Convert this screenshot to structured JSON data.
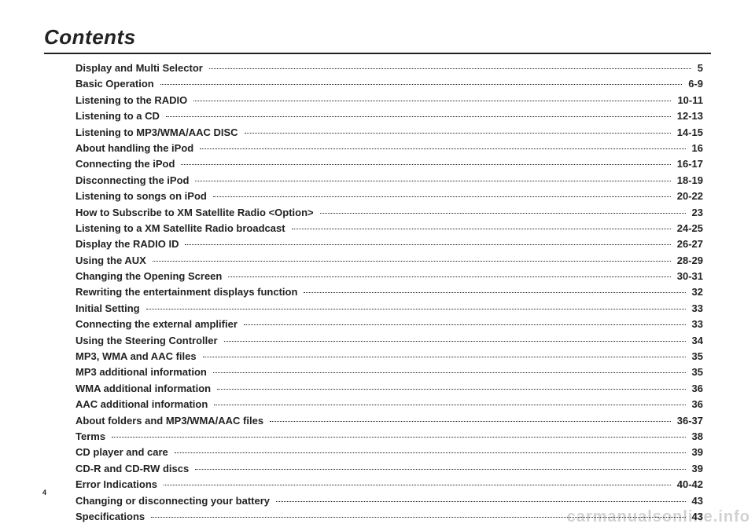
{
  "heading": "Contents",
  "page_number": "4",
  "watermark": "carmanualsonline.info",
  "toc": [
    {
      "title": "Display and Multi Selector",
      "page": "5"
    },
    {
      "title": "Basic Operation",
      "page": "6-9"
    },
    {
      "title": "Listening to the RADIO",
      "page": "10-11"
    },
    {
      "title": "Listening to a CD",
      "page": "12-13"
    },
    {
      "title": "Listening to MP3/WMA/AAC DISC",
      "page": "14-15"
    },
    {
      "title": "About handling the iPod",
      "page": "16"
    },
    {
      "title": "Connecting the iPod",
      "page": "16-17"
    },
    {
      "title": "Disconnecting the iPod",
      "page": "18-19"
    },
    {
      "title": "Listening to songs on iPod",
      "page": "20-22"
    },
    {
      "title": "How to Subscribe to XM Satellite Radio <Option>",
      "page": "23"
    },
    {
      "title": "Listening to a XM Satellite Radio broadcast",
      "page": "24-25"
    },
    {
      "title": "Display the RADIO ID",
      "page": "26-27"
    },
    {
      "title": "Using the AUX",
      "page": "28-29"
    },
    {
      "title": "Changing the Opening Screen",
      "page": "30-31"
    },
    {
      "title": "Rewriting the entertainment displays function",
      "page": "32"
    },
    {
      "title": "Initial Setting",
      "page": "33"
    },
    {
      "title": "Connecting the external amplifier",
      "page": "33"
    },
    {
      "title": "Using the Steering Controller",
      "page": "34"
    },
    {
      "title": "MP3, WMA and AAC files",
      "page": "35"
    },
    {
      "title": "MP3 additional information",
      "page": "35"
    },
    {
      "title": "WMA additional information",
      "page": "36"
    },
    {
      "title": "AAC additional information",
      "page": "36"
    },
    {
      "title": "About folders and MP3/WMA/AAC files",
      "page": "36-37"
    },
    {
      "title": "Terms",
      "page": "38"
    },
    {
      "title": "CD player and care",
      "page": "39"
    },
    {
      "title": "CD-R and CD-RW discs",
      "page": "39"
    },
    {
      "title": "Error Indications",
      "page": "40-42"
    },
    {
      "title": "Changing or disconnecting your battery",
      "page": "43"
    },
    {
      "title": "Specifications",
      "page": "43"
    }
  ]
}
